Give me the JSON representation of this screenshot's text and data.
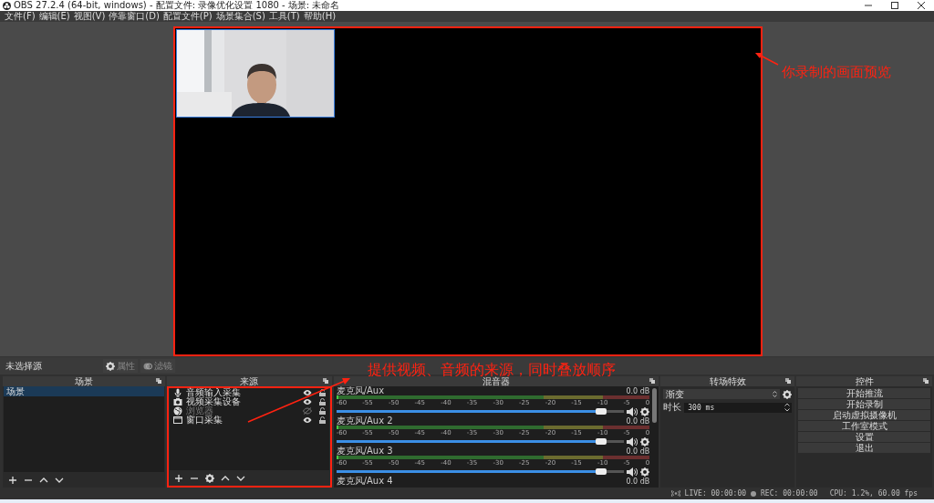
{
  "window": {
    "title": "OBS 27.2.4 (64-bit, windows) - 配置文件: 录像优化设置 1080 - 场景: 未命名"
  },
  "menu": [
    "文件(F)",
    "编辑(E)",
    "视图(V)",
    "停靠窗口(D)",
    "配置文件(P)",
    "场景集合(S)",
    "工具(T)",
    "帮助(H)"
  ],
  "preview": {
    "annotation": "你录制的画面预览"
  },
  "source_toolbar": {
    "label": "未选择源",
    "buttons": [
      {
        "label": "属性",
        "disabled": true
      },
      {
        "label": "滤镜",
        "disabled": true
      }
    ]
  },
  "scenes": {
    "title": "场景",
    "items": [
      {
        "label": "场景",
        "selected": true
      }
    ]
  },
  "sources": {
    "title": "来源",
    "annotation": "提供视频、音频的来源，同时叠放顺序",
    "items": [
      {
        "label": "音频输入采集",
        "kind": "mic",
        "visible": true
      },
      {
        "label": "视频采集设备",
        "kind": "camera",
        "visible": true
      },
      {
        "label": "浏览器",
        "kind": "browser",
        "visible": false
      },
      {
        "label": "窗口采集",
        "kind": "window",
        "visible": true
      }
    ]
  },
  "mixer": {
    "title": "混音器",
    "channels": [
      {
        "name": "麦克风/Aux",
        "reading": "0.0 dB",
        "level": 0.94,
        "scale": [
          "-60",
          "-55",
          "-50",
          "-45",
          "-40",
          "-35",
          "-30",
          "-25",
          "-20",
          "-15",
          "-10",
          "-5",
          "0"
        ]
      },
      {
        "name": "麦克风/Aux 2",
        "reading": "0.0 dB",
        "level": 0.94,
        "scale": [
          "-60",
          "-55",
          "-50",
          "-45",
          "-40",
          "-35",
          "-30",
          "-25",
          "-20",
          "-15",
          "-10",
          "-5",
          "0"
        ]
      },
      {
        "name": "麦克风/Aux 3",
        "reading": "0.0 dB",
        "level": 0.94,
        "scale": [
          "-60",
          "-55",
          "-50",
          "-45",
          "-40",
          "-35",
          "-30",
          "-25",
          "-20",
          "-15",
          "-10",
          "-5",
          "0"
        ]
      },
      {
        "name": "麦克风/Aux 4",
        "reading": "0.0 dB"
      }
    ]
  },
  "transitions": {
    "title": "转场特效",
    "transition": "渐变",
    "duration_label": "时长",
    "duration": "300 ms"
  },
  "controls": {
    "title": "控件",
    "buttons": [
      "开始推流",
      "开始录制",
      "启动虚拟摄像机",
      "工作室模式",
      "设置",
      "退出"
    ]
  },
  "status_bar": {
    "live": "LIVE: 00:00:00",
    "rec": "REC: 00:00:00",
    "cpu": "CPU: 1.2%, 60.00 fps"
  }
}
